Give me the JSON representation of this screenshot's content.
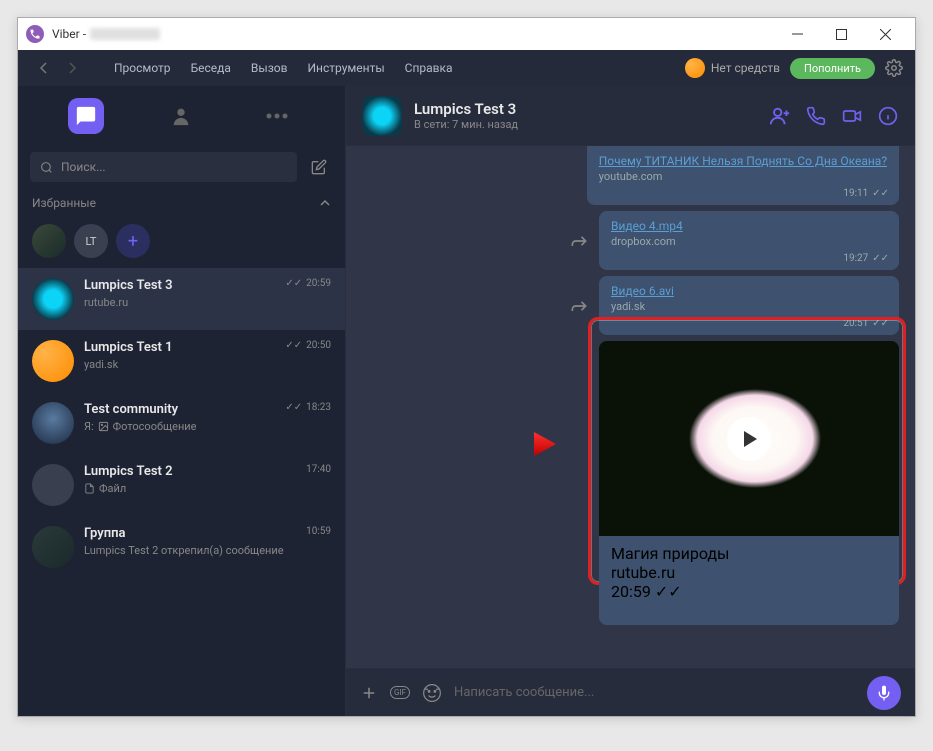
{
  "window": {
    "title": "Viber -"
  },
  "toolbar": {
    "menu": [
      "Просмотр",
      "Беседа",
      "Вызов",
      "Инструменты",
      "Справка"
    ],
    "balance_label": "Нет средств",
    "topup_label": "Пополнить"
  },
  "sidebar": {
    "search_placeholder": "Поиск...",
    "favorites_label": "Избранные",
    "favorites": [
      {
        "initials": ""
      },
      {
        "initials": "LT"
      }
    ],
    "chats": [
      {
        "name": "Lumpics Test 3",
        "sub": "rutube.ru",
        "time": "20:59",
        "read": true,
        "active": true,
        "ava": "cyan"
      },
      {
        "name": "Lumpics Test 1",
        "sub": "yadi.sk",
        "time": "20:50",
        "read": true,
        "ava": "orange"
      },
      {
        "name": "Test community",
        "sub_prefix": "Я:",
        "sub": "Фотосообщение",
        "time": "18:23",
        "read": true,
        "ava": "blur",
        "photo_icon": true
      },
      {
        "name": "Lumpics Test 2",
        "sub": "Файл",
        "time": "17:40",
        "ava": "grey",
        "file_icon": true
      },
      {
        "name": "Группа",
        "sub": "Lumpics Test 2 открепил(а) сообщение",
        "time": "10:59",
        "ava": "grp"
      }
    ]
  },
  "chat": {
    "title": "Lumpics Test 3",
    "status": "В сети: 7 мин. назад",
    "messages": [
      {
        "link": "Почему ТИТАНИК Нельзя Поднять Со Дна Океана?",
        "src": "youtube.com",
        "time": "19:11",
        "forward": false
      },
      {
        "link": "Видео 4.mp4",
        "src": "dropbox.com",
        "time": "19:27",
        "forward": true
      },
      {
        "link": "Видео 6.avi",
        "src": "yadi.sk",
        "time": "20:51",
        "forward": true
      },
      {
        "preview": true,
        "link": "Магия природы",
        "src": "rutube.ru",
        "time": "20:59"
      }
    ],
    "composer_placeholder": "Написать сообщение..."
  }
}
